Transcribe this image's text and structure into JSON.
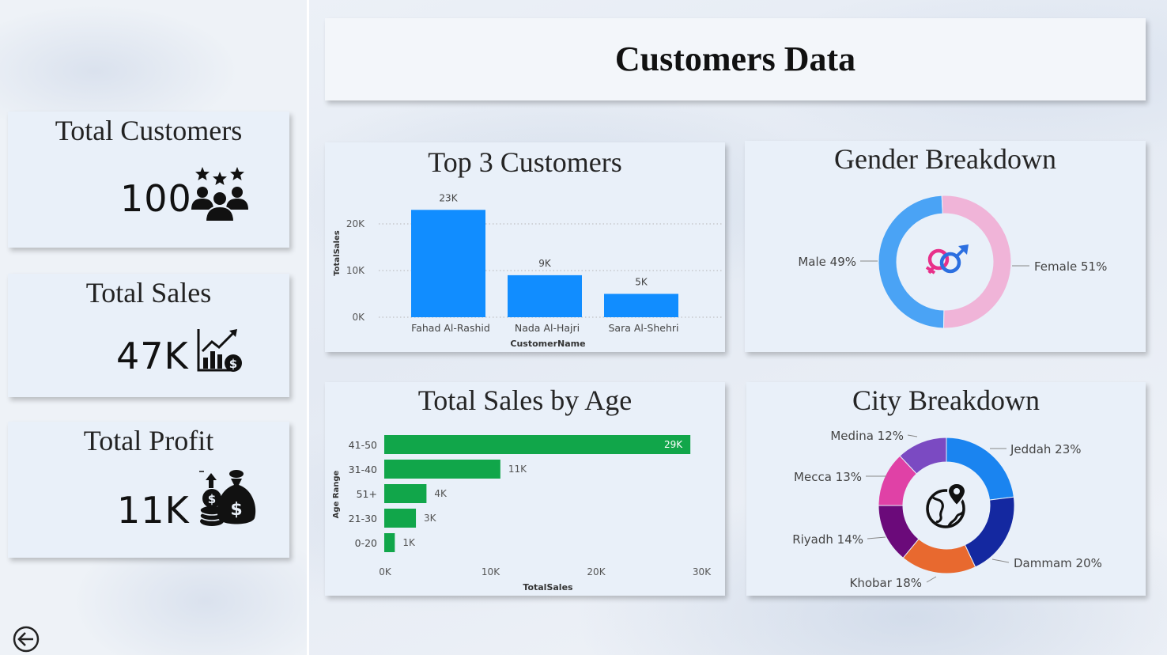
{
  "header": {
    "title": "Customers Data"
  },
  "kpis": {
    "customers": {
      "title": "Total Customers",
      "value": "100",
      "icon": "customers-stars-icon"
    },
    "sales": {
      "title": "Total Sales",
      "value": "47K",
      "icon": "sales-growth-icon"
    },
    "profit": {
      "title": "Total Profit",
      "value": "11K",
      "icon": "money-bags-icon"
    }
  },
  "panels": {
    "top_customers": {
      "title": "Top 3 Customers"
    },
    "gender": {
      "title": "Gender Breakdown"
    },
    "age": {
      "title": "Total Sales by Age"
    },
    "city": {
      "title": "City Breakdown"
    }
  },
  "navigation": {
    "back_icon": "back-arrow-icon"
  },
  "colors": {
    "bar_blue": "#118dff",
    "bar_green": "#11a64a",
    "male": "#4aa3f5",
    "female": "#f0b4d8"
  },
  "chart_data": [
    {
      "id": "top_customers",
      "type": "bar",
      "categories": [
        "Fahad Al-Rashid",
        "Nada Al-Hajri",
        "Sara Al-Shehri"
      ],
      "values": [
        23000,
        9000,
        5000
      ],
      "data_labels": [
        "23K",
        "9K",
        "5K"
      ],
      "xlabel": "CustomerName",
      "ylabel": "TotalSales",
      "ylim": [
        0,
        25000
      ],
      "y_ticks": [
        0,
        10000,
        20000
      ],
      "y_tick_labels": [
        "0K",
        "10K",
        "20K"
      ],
      "grid": true
    },
    {
      "id": "gender",
      "type": "pie",
      "donut": true,
      "center_icon": "gender-symbols-icon",
      "slices": [
        {
          "label": "Male 49%",
          "value": 49,
          "color": "#4aa3f5"
        },
        {
          "label": "Female 51%",
          "value": 51,
          "color": "#f0b4d8"
        }
      ]
    },
    {
      "id": "age",
      "type": "bar",
      "orientation": "horizontal",
      "categories": [
        "41-50",
        "31-40",
        "51+",
        "21-30",
        "0-20"
      ],
      "values": [
        29000,
        11000,
        4000,
        3000,
        1000
      ],
      "data_labels": [
        "29K",
        "11K",
        "4K",
        "3K",
        "1K"
      ],
      "xlabel": "TotalSales",
      "ylabel": "Age Range",
      "xlim": [
        0,
        30000
      ],
      "x_ticks": [
        0,
        10000,
        20000,
        30000
      ],
      "x_tick_labels": [
        "0K",
        "10K",
        "20K",
        "30K"
      ]
    },
    {
      "id": "city",
      "type": "pie",
      "donut": true,
      "center_icon": "globe-location-icon",
      "slices": [
        {
          "label": "Jeddah 23%",
          "value": 23,
          "color": "#1a84f0"
        },
        {
          "label": "Dammam 20%",
          "value": 20,
          "color": "#1428a0"
        },
        {
          "label": "Khobar 18%",
          "value": 18,
          "color": "#e8692f"
        },
        {
          "label": "Riyadh 14%",
          "value": 14,
          "color": "#6b0a7a"
        },
        {
          "label": "Mecca 13%",
          "value": 13,
          "color": "#e041a6"
        },
        {
          "label": "Medina 12%",
          "value": 12,
          "color": "#7b4ac2"
        }
      ]
    }
  ]
}
